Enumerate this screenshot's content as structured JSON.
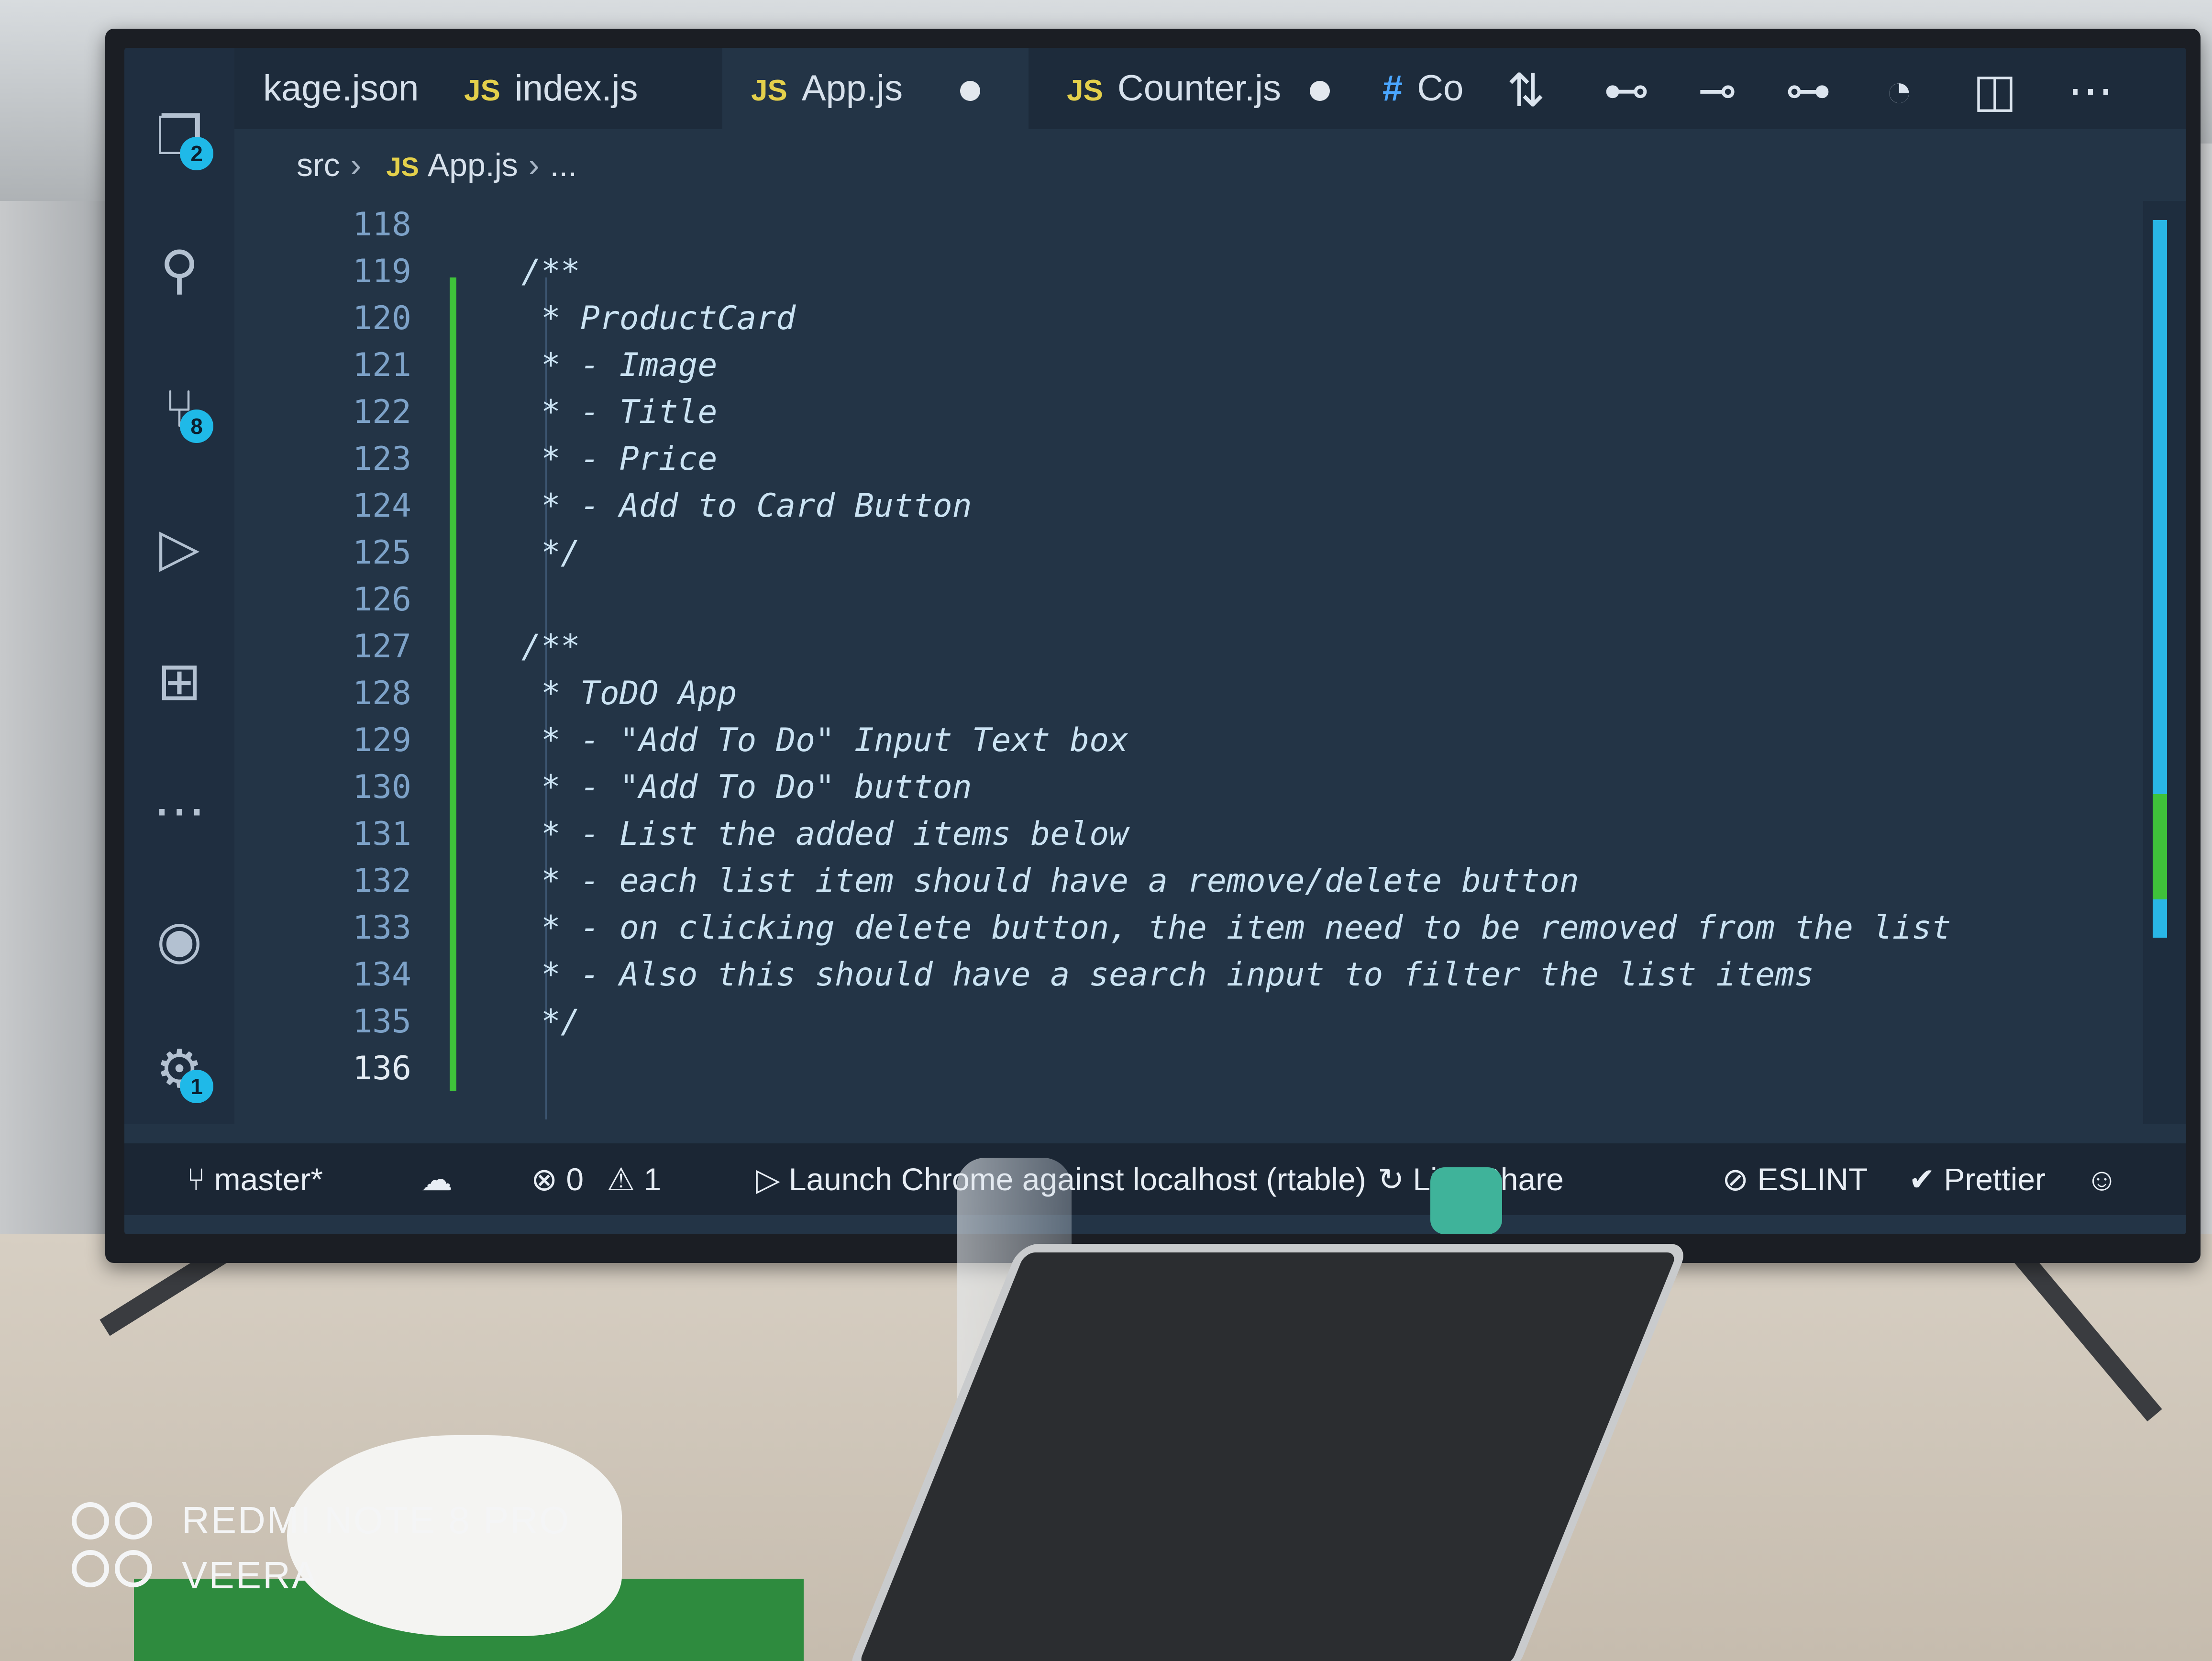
{
  "tabs": [
    {
      "prefix": "",
      "label": "kage.json"
    },
    {
      "prefix": "JS",
      "label": "index.js"
    },
    {
      "prefix": "JS",
      "label": "App.js",
      "active": true,
      "modified": true
    },
    {
      "prefix": "JS",
      "label": "Counter.js",
      "modified": true
    },
    {
      "prefix": "#",
      "label": "Co"
    }
  ],
  "breadcrumb": {
    "folder": "src",
    "file_prefix": "JS",
    "file": "App.js",
    "more": "..."
  },
  "activity_bar": {
    "explorer_badge": "2",
    "scm_badge": "8",
    "settings_badge": "1"
  },
  "editor": {
    "lines": [
      {
        "num": "118",
        "text": ""
      },
      {
        "num": "119",
        "text": "/**"
      },
      {
        "num": "120",
        "text": " * ProductCard"
      },
      {
        "num": "121",
        "text": " * - Image"
      },
      {
        "num": "122",
        "text": " * - Title"
      },
      {
        "num": "123",
        "text": " * - Price"
      },
      {
        "num": "124",
        "text": " * - Add to Card Button"
      },
      {
        "num": "125",
        "text": " */"
      },
      {
        "num": "126",
        "text": ""
      },
      {
        "num": "127",
        "text": "/**"
      },
      {
        "num": "128",
        "text": " * ToDO App"
      },
      {
        "num": "129",
        "text": " * - \"Add To Do\" Input Text box"
      },
      {
        "num": "130",
        "text": " * - \"Add To Do\" button"
      },
      {
        "num": "131",
        "text": " * - List the added items below"
      },
      {
        "num": "132",
        "text": " * - each list item should have a remove/delete button"
      },
      {
        "num": "133",
        "text": " * - on clicking delete button, the item need to be removed from the list"
      },
      {
        "num": "134",
        "text": " * - Also this should have a search input to filter the list items"
      },
      {
        "num": "135",
        "text": " */"
      },
      {
        "num": "136",
        "text": ""
      }
    ]
  },
  "statusbar": {
    "branch": "master*",
    "errors": "0",
    "warnings": "1",
    "launch": "Launch Chrome against localhost (rtable)",
    "live_share": "Live Share",
    "eslint": "ESLINT",
    "prettier": "Prettier"
  },
  "watermark": {
    "line1": "REDMI NOTE 8 PRO",
    "line2": "VEERA"
  },
  "colors": {
    "editor_bg": "#233446",
    "accent": "#29b6e6",
    "git_added": "#3fc23a",
    "js_badge": "#e4d04b"
  }
}
